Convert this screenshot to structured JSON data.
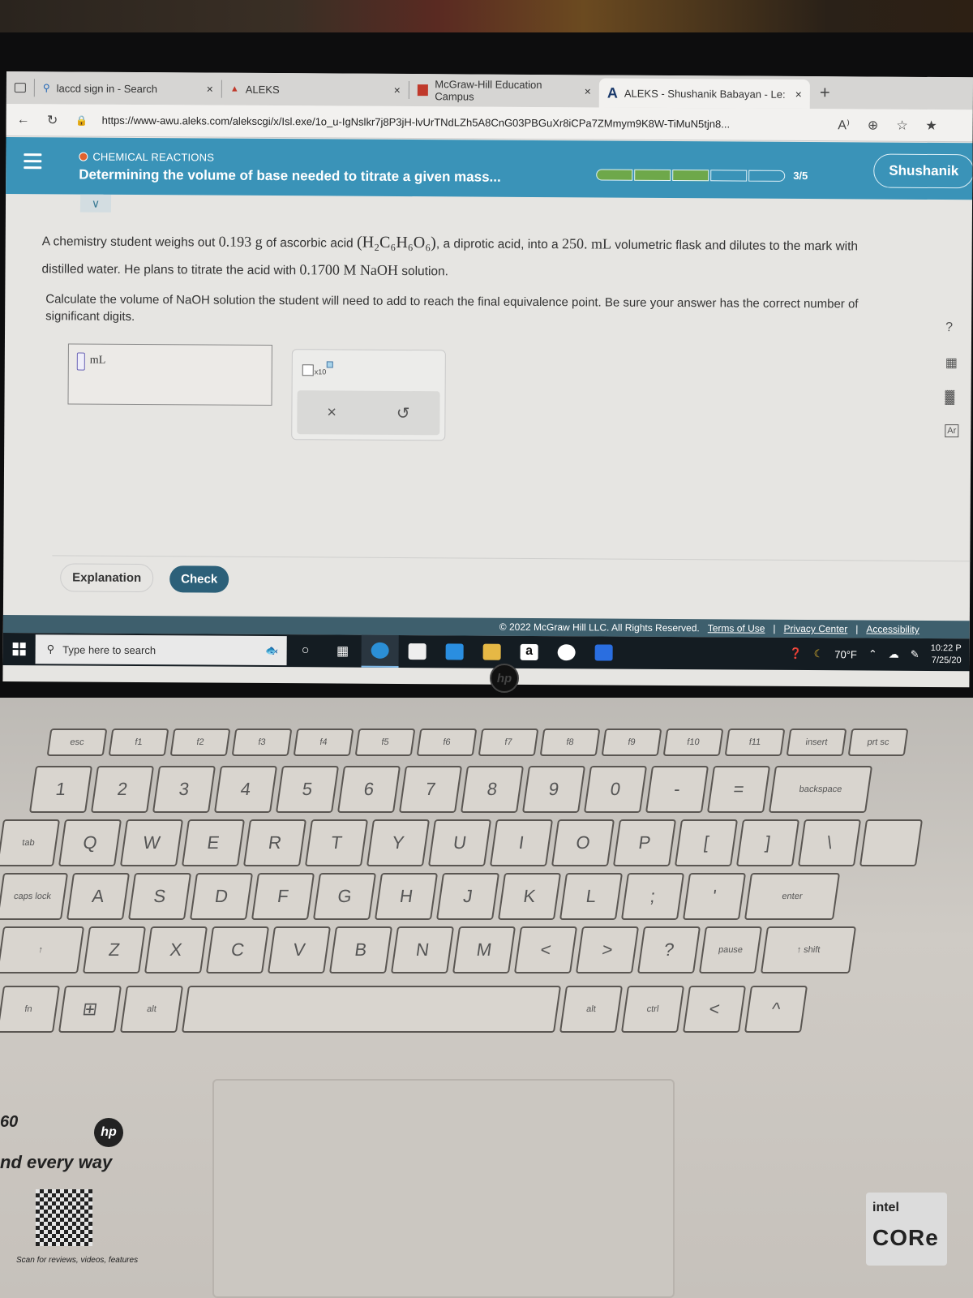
{
  "browser": {
    "tabs": [
      {
        "label": "laccd sign in - Search",
        "icon": "search-icon"
      },
      {
        "label": "ALEKS",
        "icon": "aleks-icon"
      },
      {
        "label": "McGraw-Hill Education Campus",
        "icon": "mcgraw-hill-icon"
      },
      {
        "label": "ALEKS - Shushanik Babayan - Le:",
        "icon": "aleks-a-icon",
        "active": true
      }
    ],
    "new_tab": "+",
    "close_glyph": "×",
    "url": "https://www-awu.aleks.com/alekscgi/x/Isl.exe/1o_u-IgNslkr7j8P3jH-lvUrTNdLZh5A8CnG03PBGuXr8iCPa7ZMmym9K8W-TiMuN5tjn8...",
    "read_aloud": "A⁾",
    "zoom": "⊕",
    "favorite": "☆",
    "favorites": "★"
  },
  "aleks": {
    "category": "CHEMICAL REACTIONS",
    "topic_title": "Determining the volume of base needed to titrate a given mass...",
    "progress": {
      "completed": 3,
      "total": 5,
      "label": "3/5"
    },
    "user_name": "Shushanik",
    "collapse_glyph": "∨",
    "question": {
      "p1_a": "A chemistry student weighs out ",
      "mass": "0.193 g",
      "p1_b": " of ascorbic acid ",
      "formula": "(H₂C₆H₆O₆)",
      "p1_c": ", a diprotic acid, into a ",
      "volume": "250. mL",
      "p1_d": " volumetric flask and dilutes to the mark with distilled water. He plans to titrate the acid with ",
      "concentration": "0.1700 M NaOH",
      "p1_e": " solution."
    },
    "instruction": "Calculate the volume of NaOH solution the student will need to add to reach the final equivalence point. Be sure your answer has the correct number of significant digits.",
    "answer": {
      "value": "",
      "unit": "mL"
    },
    "tools": {
      "sci_label": "x10",
      "clear": "×",
      "undo": "↺"
    },
    "right_tools": [
      "?",
      "▦",
      "▓",
      "Ar"
    ],
    "buttons": {
      "explanation": "Explanation",
      "check": "Check"
    },
    "footer": {
      "copyright": "© 2022 McGraw Hill LLC. All Rights Reserved.",
      "terms": "Terms of Use",
      "privacy": "Privacy Center",
      "accessibility": "Accessibility",
      "sep": "|"
    }
  },
  "taskbar": {
    "search_placeholder": "Type here to search",
    "weather": "70°F",
    "time": "10:22 P",
    "date": "7/25/20"
  },
  "physical": {
    "keys_row1": [
      "esc",
      "f1",
      "f2",
      "f3",
      "f4",
      "f5",
      "f6",
      "f7",
      "f8",
      "f9",
      "f10",
      "f11",
      "insert",
      "prt sc"
    ],
    "keys_row2": [
      "1",
      "2",
      "3",
      "4",
      "5",
      "6",
      "7",
      "8",
      "9",
      "0",
      "-",
      "=",
      "backspace"
    ],
    "keys_row3": [
      "tab",
      "Q",
      "W",
      "E",
      "R",
      "T",
      "Y",
      "U",
      "I",
      "O",
      "P",
      "[",
      "]",
      "\\"
    ],
    "keys_row4": [
      "caps lock",
      "A",
      "S",
      "D",
      "F",
      "G",
      "H",
      "J",
      "K",
      "L",
      ";",
      "'",
      "enter"
    ],
    "keys_row5": [
      "↑",
      "Z",
      "X",
      "C",
      "V",
      "B",
      "N",
      "M",
      "<",
      ">",
      "?",
      "pause",
      "↑ shift"
    ],
    "keys_row6": [
      "fn",
      "⊞",
      "alt",
      "",
      "alt",
      "ctrl",
      "<",
      "^"
    ],
    "sticker_number": "60",
    "sticker_text": "nd every way",
    "scan_text": "Scan for reviews, videos, features",
    "hp": "hp",
    "intel": "intel",
    "core": "CORe"
  }
}
